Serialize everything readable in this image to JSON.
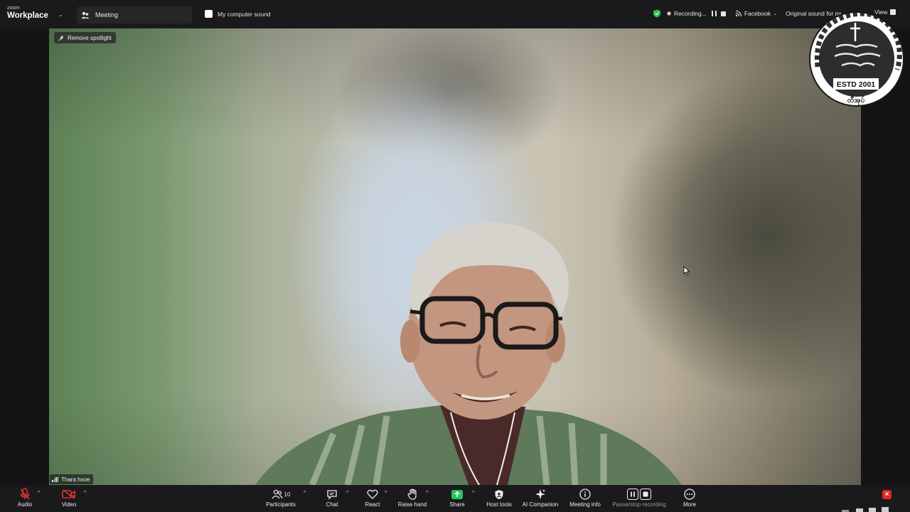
{
  "app": {
    "brand_small": "zoom",
    "brand_big": "Workplace"
  },
  "topbar": {
    "meeting_tab": "Meeting",
    "computer_sound": "My computer sound",
    "recording_label": "Recording...",
    "live_target": "Facebook",
    "original_sound": "Original sound for musicians",
    "view_label": "View"
  },
  "video": {
    "spotlight_button": "Remove spotlight",
    "participant_name": "Thara hsoe"
  },
  "logo": {
    "estd": "ESTD 2001",
    "bottom_text": "တီအုပ်"
  },
  "toolbar": {
    "audio": "Audio",
    "video": "Video",
    "participants": "Participants",
    "participants_count": "10",
    "chat": "Chat",
    "react": "React",
    "raise_hand": "Raise hand",
    "share": "Share",
    "host_tools": "Host tools",
    "ai_companion": "AI Companion",
    "meeting_info": "Meeting info",
    "pause_stop": "Pause/stop recording",
    "more": "More"
  },
  "colors": {
    "share_green": "#22c55e",
    "muted_red": "#e0342f",
    "end_red": "#e02828",
    "shield_green": "#27c24c"
  }
}
